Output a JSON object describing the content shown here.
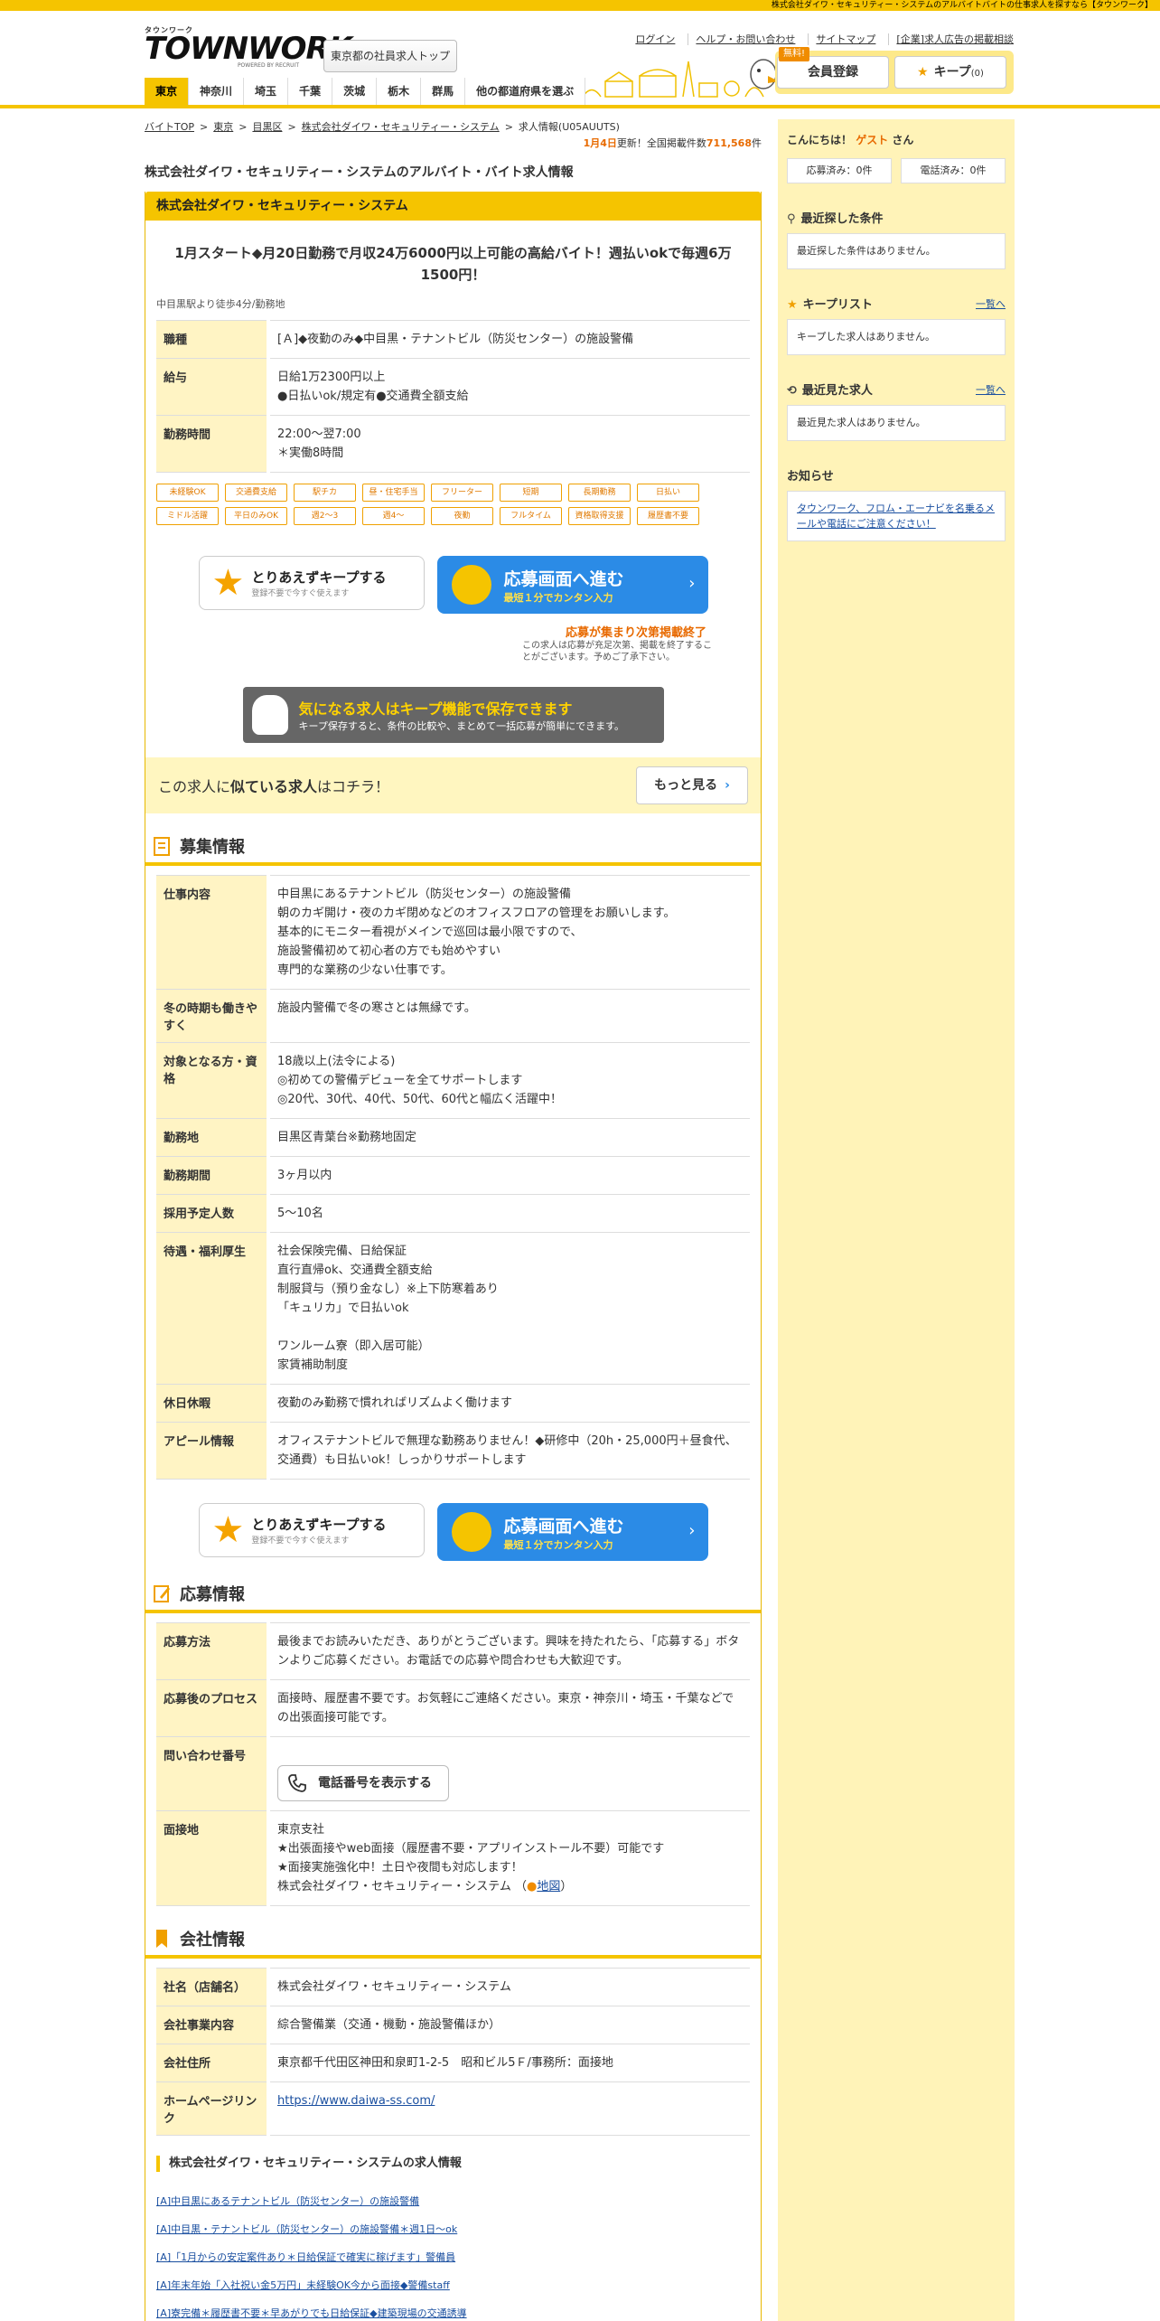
{
  "top_strip": "株式会社ダイワ・セキュリティー・システムのアルバイトバイトの仕事求人を探すなら【タウンワーク】",
  "logo": {
    "small": "タウンワーク",
    "big_a": "TOWN",
    "big_b": "WORK",
    "powered": "POWERED BY RECRUIT"
  },
  "header": {
    "area_top": "東京都の社員求人トップ",
    "links": [
      "ログイン",
      "ヘルプ・お問い合わせ",
      "サイトマップ",
      "[企業]求人広告の掲載相談"
    ],
    "free_badge": "無料!",
    "register": "会員登録",
    "keep": "キープ",
    "keep_count": "(0)"
  },
  "nav": [
    "東京",
    "神奈川",
    "埼玉",
    "千葉",
    "茨城",
    "栃木",
    "群馬",
    "他の都道府県を選ぶ"
  ],
  "breadcrumb": [
    "バイトTOP",
    "東京",
    "目黒区",
    "株式会社ダイワ・セキュリティー・システム",
    "求人情報(U05AUUTS)"
  ],
  "update": {
    "date": "1月4日",
    "mid": "更新！全国掲載件数",
    "count": "711,568",
    "suffix": "件"
  },
  "page_title": "株式会社ダイワ・セキュリティー・システムのアルバイト・バイト求人情報",
  "job": {
    "company": "株式会社ダイワ・セキュリティー・システム",
    "catch": "1月スタート◆月20日勤務で月収24万6000円以上可能の高給バイト！週払いokで毎週6万1500円！",
    "station": "中目黒駅より徒歩4分/勤務地",
    "summary": [
      {
        "th": "職種",
        "td": "[Ａ]◆夜勤のみ◆中目黒・テナントビル（防災センター）の施設警備"
      },
      {
        "th": "給与",
        "td": "日給1万2300円以上\n●日払いok/規定有●交通費全額支給"
      },
      {
        "th": "勤務時間",
        "td": "22:00～翌7:00\n＊実働8時間"
      }
    ],
    "tags": [
      "未経験OK",
      "交通費支給",
      "駅チカ",
      "昼・住宅手当",
      "フリーター",
      "短期",
      "長期勤務",
      "日払い",
      "ミドル活躍",
      "平日のみOK",
      "週2～3",
      "週4～",
      "夜勤",
      "フルタイム",
      "資格取得支援",
      "履歴書不要"
    ],
    "keep_btn": {
      "t1": "とりあえずキープする",
      "t2": "登録不要で今すぐ使えます"
    },
    "apply_btn": {
      "t1": "応募画面へ進む",
      "t2": "最短１分でカンタン入力"
    },
    "ending": {
      "t1": "応募が集まり次第掲載終了",
      "t2": "この求人は応募が充足次第、掲載を終了することがございます。予めご了承下さい。"
    },
    "keep_banner": {
      "t1": "気になる求人はキープ機能で保存できます",
      "t2": "キープ保存すると、条件の比較や、まとめて一括応募が簡単にできます。"
    },
    "similar": {
      "pre": "この求人に",
      "bold": "似ている求人",
      "post": "はコチラ！",
      "btn": "もっと見る"
    }
  },
  "recruit": {
    "title": "募集情報",
    "rows": [
      {
        "th": "仕事内容",
        "td": "中目黒にあるテナントビル（防災センター）の施設警備\n朝のカギ開け・夜のカギ閉めなどのオフィスフロアの管理をお願いします。\n基本的にモニター看視がメインで巡回は最小限ですので、\n施設警備初めて初心者の方でも始めやすい\n専門的な業務の少ない仕事です。"
      },
      {
        "th": "冬の時期も働きやすく",
        "td": "施設内警備で冬の寒さとは無縁です。"
      },
      {
        "th": "対象となる方・資格",
        "td": "18歳以上(法令による)\n◎初めての警備デビューを全てサポートします\n◎20代、30代、40代、50代、60代と幅広く活躍中！"
      },
      {
        "th": "勤務地",
        "td": "目黒区青葉台※勤務地固定"
      },
      {
        "th": "勤務期間",
        "td": "3ヶ月以内"
      },
      {
        "th": "採用予定人数",
        "td": "5～10名"
      },
      {
        "th": "待遇・福利厚生",
        "td": "社会保険完備、日給保証\n直行直帰ok、交通費全額支給\n制服貸与（預り金なし）※上下防寒着あり\n「キュリカ」で日払いok\n\nワンルーム寮（即入居可能）\n家賃補助制度"
      },
      {
        "th": "休日休暇",
        "td": "夜勤のみ勤務で慣れればリズムよく働けます"
      },
      {
        "th": "アピール情報",
        "td": "オフィステナントビルで無理な勤務ありません！◆研修中（20h・25,000円＋昼食代、交通費）も日払いok！しっかりサポートします"
      }
    ]
  },
  "apply": {
    "title": "応募情報",
    "method_th": "応募方法",
    "method_td": "最後までお読みいただき、ありがとうございます。興味を持たれたら、「応募する」ボタンよりご応募ください。お電話での応募や問合わせも大歓迎です。",
    "process_th": "応募後のプロセス",
    "process_td": "面接時、履歴書不要です。お気軽にご連絡ください。東京・神奈川・埼玉・千葉などでの出張面接可能です。",
    "tel_th": "問い合わせ番号",
    "tel_btn": "電話番号を表示する",
    "place_th": "面接地",
    "place_td": "東京支社\n★出張面接やweb面接（履歴書不要・アプリインストール不要）可能です\n★面接実施強化中！土日や夜間も対応します！",
    "place_company": "株式会社ダイワ・セキュリティー・システム （",
    "map_link": "地図",
    "place_close": "）"
  },
  "company": {
    "title": "会社情報",
    "rows": [
      {
        "th": "社名（店舗名）",
        "td": "株式会社ダイワ・セキュリティー・システム"
      },
      {
        "th": "会社事業内容",
        "td": "綜合警備業（交通・機動・施設警備ほか）"
      },
      {
        "th": "会社住所",
        "td": "東京都千代田区神田和泉町1-2-5　昭和ビル5Ｆ/事務所：面接地"
      }
    ],
    "hp_th": "ホームページリンク",
    "hp_link": "https://www.daiwa-ss.com/"
  },
  "related": {
    "title": "株式会社ダイワ・セキュリティー・システムの求人情報",
    "items": [
      "[A]中目黒にあるテナントビル（防災センター）の施設警備",
      "[A]中目黒・テナントビル（防災センター）の施設警備＊週1日～ok",
      "[A]「1月からの安定案件あり＊日給保証で確実に稼げます」警備員",
      "[A]年末年始「入社祝い金5万円」未経験OK今から面接◆警備staff",
      "[A]寮完備＊履歴書不要＊早あがりでも日給保証◆建築現場の交通誘導"
    ]
  },
  "sidebar": {
    "hello_pre": "こんにちは！",
    "guest": "ゲスト",
    "hello_post": "さん",
    "applied": "応募済み：0件",
    "called": "電話済み：0件",
    "recent_cond_title": "最近探した条件",
    "recent_cond_empty": "最近探した条件はありません。",
    "keep_title": "キープリスト",
    "keep_more": "一覧へ",
    "keep_empty": "キープした求人はありません。",
    "seen_title": "最近見た求人",
    "seen_more": "一覧へ",
    "seen_empty": "最近見た求人はありません。",
    "notice_title": "お知らせ",
    "notice_text": "タウンワーク、フロム・エーナビを名乗るメールや電話にご注意ください！"
  },
  "colors": {
    "brand_yellow": "#f5c400",
    "apply_blue": "#2b8be6",
    "accent_orange": "#e86a00"
  }
}
